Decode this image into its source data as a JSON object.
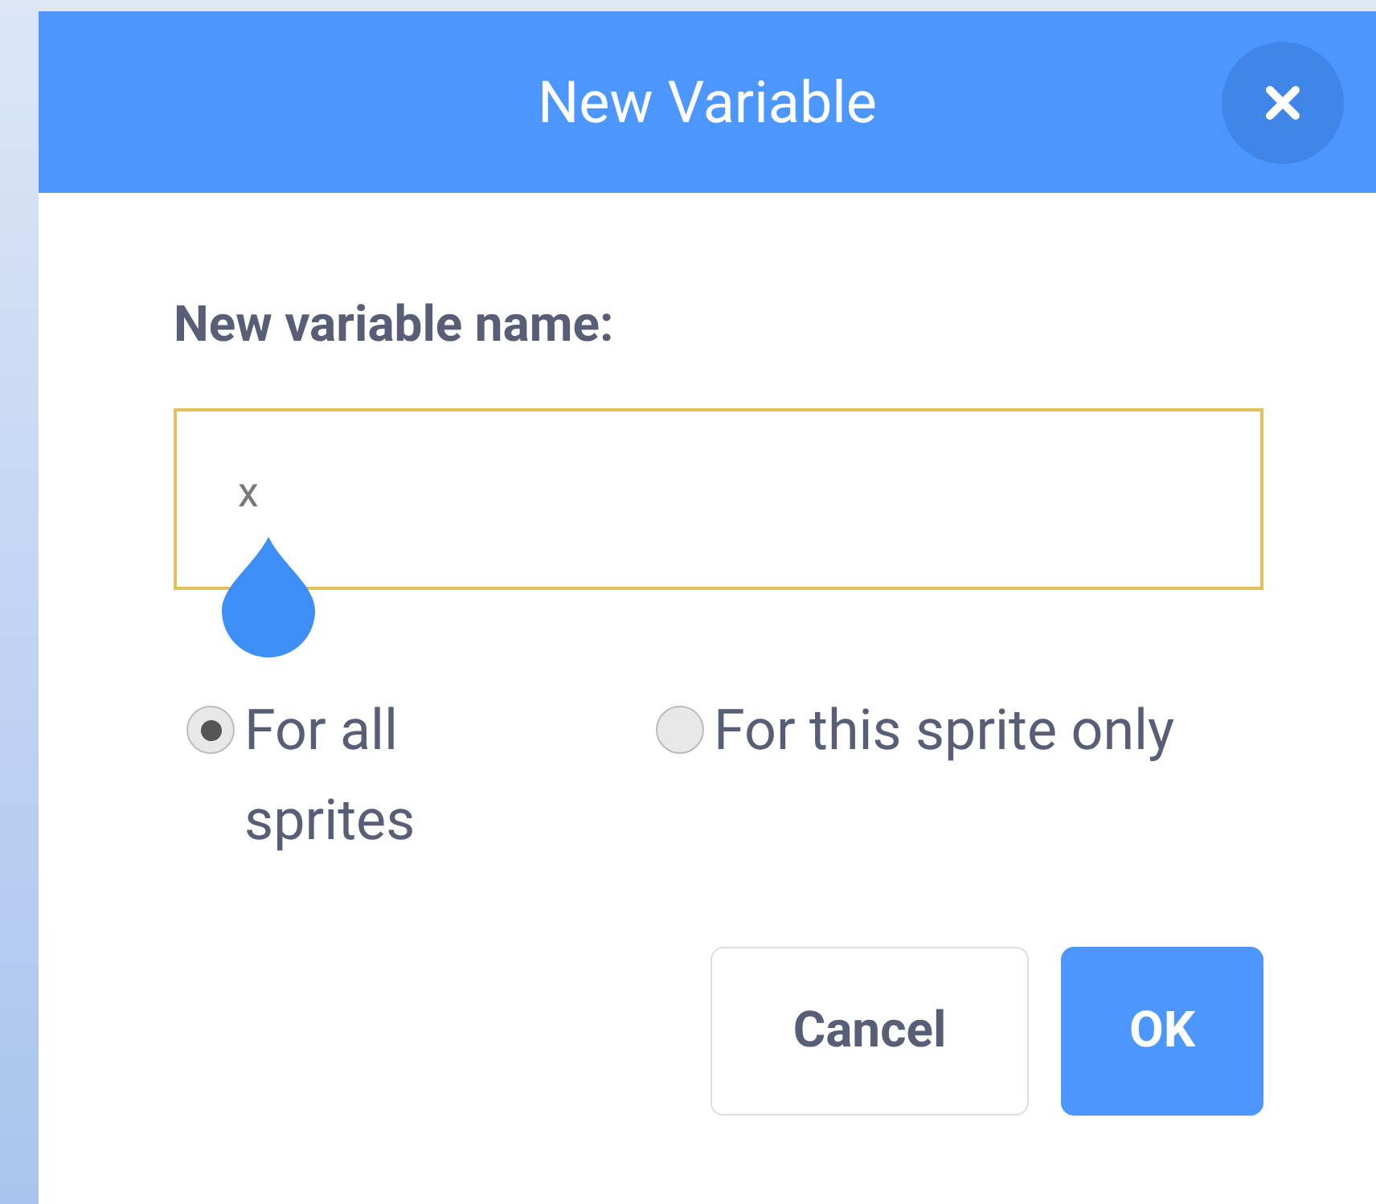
{
  "dialog": {
    "title": "New Variable"
  },
  "field": {
    "label": "New variable name:",
    "value": "x"
  },
  "scope_options": [
    {
      "label": "For all sprites",
      "selected": true
    },
    {
      "label": "For this sprite only",
      "selected": false
    }
  ],
  "buttons": [
    {
      "label": "Cancel",
      "kind": "secondary"
    },
    {
      "label": "OK",
      "kind": "primary"
    }
  ]
}
